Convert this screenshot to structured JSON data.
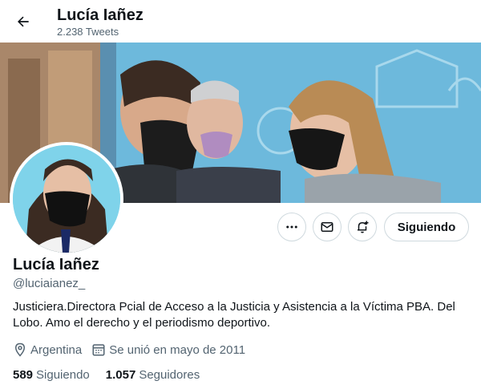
{
  "header": {
    "title": "Lucía Iañez",
    "subtitle": "2.238 Tweets",
    "back_icon": "arrow-left-icon"
  },
  "profile": {
    "name": "Lucía Iañez",
    "handle": "@luciaianez_",
    "bio": "Justiciera.Directora Pcial de Acceso a la Justicia y Asistencia a la Víctima PBA. Del Lobo. Amo el derecho y el periodismo deportivo.",
    "location": "Argentina",
    "joined": "Se unió en mayo de 2011"
  },
  "actions": {
    "more_icon": "more-icon",
    "message_icon": "mail-icon",
    "notify_icon": "bell-plus-icon",
    "follow_label": "Siguiendo"
  },
  "stats": {
    "following_count": "589",
    "following_label": "Siguiendo",
    "followers_count": "1.057",
    "followers_label": "Seguidores"
  },
  "colors": {
    "text": "#0f1419",
    "secondary": "#536471",
    "border": "#cfd9de"
  }
}
